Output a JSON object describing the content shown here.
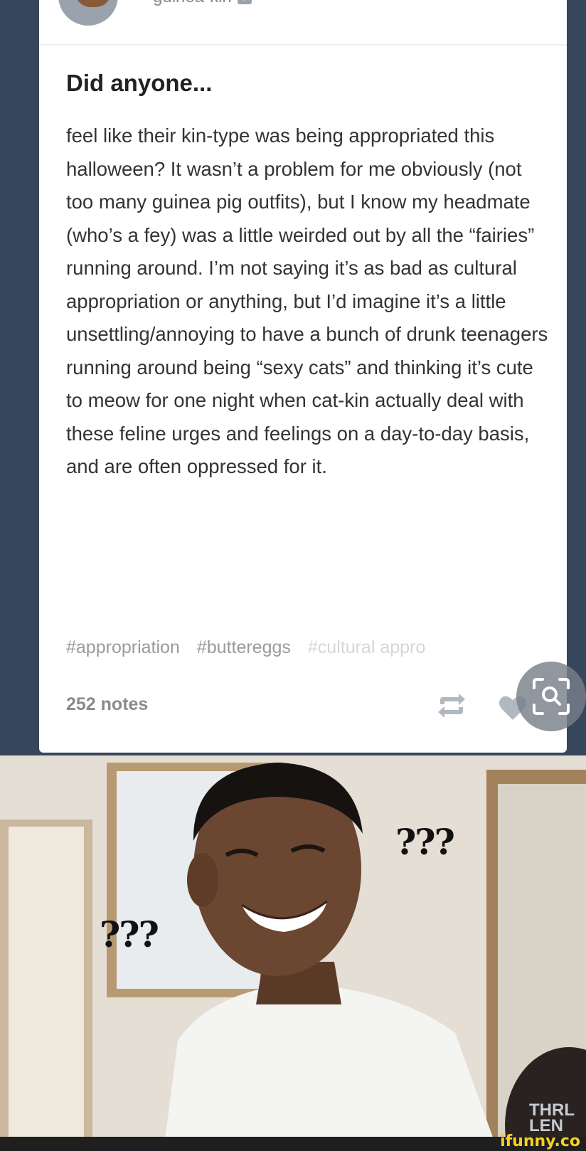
{
  "post": {
    "username": "guinea-kin",
    "follow_icon": "plus-square-icon",
    "title": "Did anyone...",
    "body": "feel like their kin-type was being appropriated this halloween? It wasn’t a problem for me obviously (not too many guinea pig outfits), but I know my headmate (who’s a fey) was a little weirded out by all the “fairies” running around. I’m not saying it’s as bad as cultural appropriation or anything, but I’d imagine it’s a little unsettling/annoying to have a bunch of drunk teenagers running around being “sexy cats” and thinking it’s cute to meow for one night when cat-kin actually deal with these feline urges and feelings on a day-to-day basis, and are often oppressed for it.",
    "tags": [
      "#appropriation",
      "#buttereggs",
      "#cultural appro"
    ],
    "notes": "252 notes",
    "icons": {
      "reblog": "reblog-icon",
      "like": "heart-icon",
      "lens": "lens-search-icon"
    }
  },
  "meme": {
    "question_marks_right": "???",
    "question_marks_left": "???",
    "corner_text": "THRL LEN"
  },
  "watermark": "ifunny.co",
  "colors": {
    "dashboard_bg": "#36465d",
    "card_bg": "#ffffff",
    "tag_text": "#9a9a9a",
    "watermark": "#f7d21b"
  }
}
